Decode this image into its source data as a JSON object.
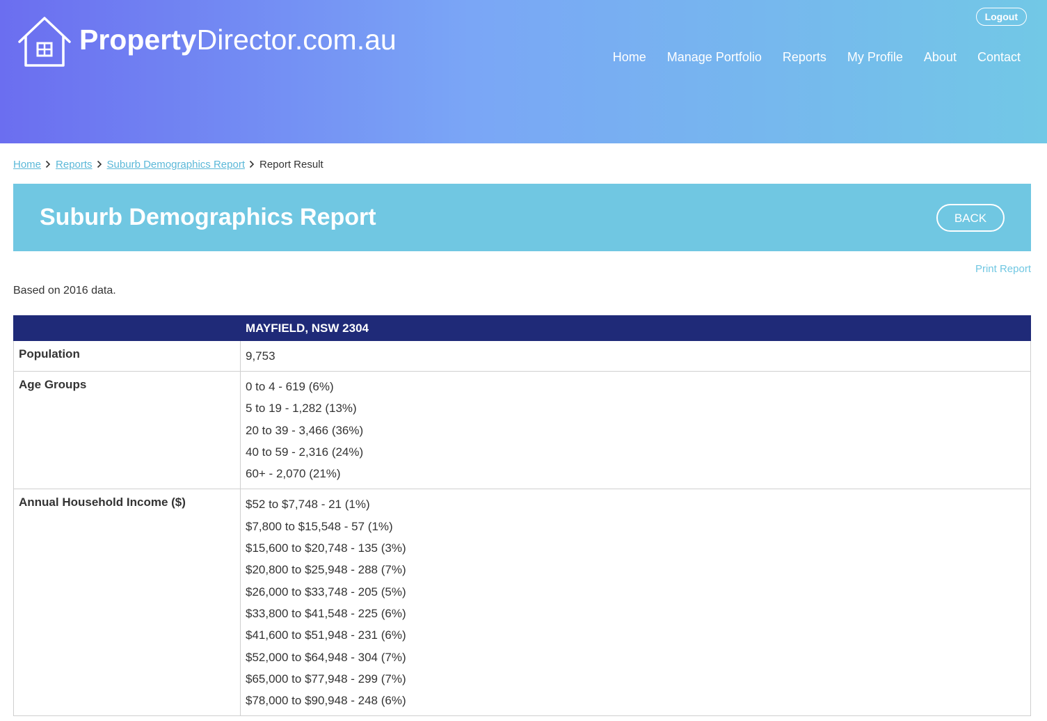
{
  "header": {
    "logo_bold": "Property",
    "logo_light": "Director.com.au",
    "logout_label": "Logout",
    "nav": [
      {
        "label": "Home"
      },
      {
        "label": "Manage Portfolio"
      },
      {
        "label": "Reports"
      },
      {
        "label": "My Profile"
      },
      {
        "label": "About"
      },
      {
        "label": "Contact"
      }
    ]
  },
  "breadcrumb": {
    "items": [
      {
        "label": "Home"
      },
      {
        "label": "Reports"
      },
      {
        "label": "Suburb Demographics Report"
      }
    ],
    "current": "Report Result"
  },
  "page": {
    "title": "Suburb Demographics Report",
    "back_label": "BACK",
    "print_label": "Print Report",
    "note": "Based on 2016 data."
  },
  "table": {
    "header_location": "MAYFIELD, NSW 2304",
    "rows": [
      {
        "label": "Population",
        "values": [
          "9,753"
        ]
      },
      {
        "label": "Age Groups",
        "values": [
          "0 to 4 - 619 (6%)",
          "5 to 19 - 1,282 (13%)",
          "20 to 39 - 3,466 (36%)",
          "40 to 59 - 2,316 (24%)",
          "60+ - 2,070 (21%)"
        ]
      },
      {
        "label": "Annual Household Income ($)",
        "values": [
          "$52 to $7,748 - 21 (1%)",
          "$7,800 to $15,548 - 57 (1%)",
          "$15,600 to $20,748 - 135 (3%)",
          "$20,800 to $25,948 - 288 (7%)",
          "$26,000 to $33,748 - 205 (5%)",
          "$33,800 to $41,548 - 225 (6%)",
          "$41,600 to $51,948 - 231 (6%)",
          "$52,000 to $64,948 - 304 (7%)",
          "$65,000 to $77,948 - 299 (7%)",
          "$78,000 to $90,948 - 248 (6%)"
        ]
      }
    ]
  }
}
